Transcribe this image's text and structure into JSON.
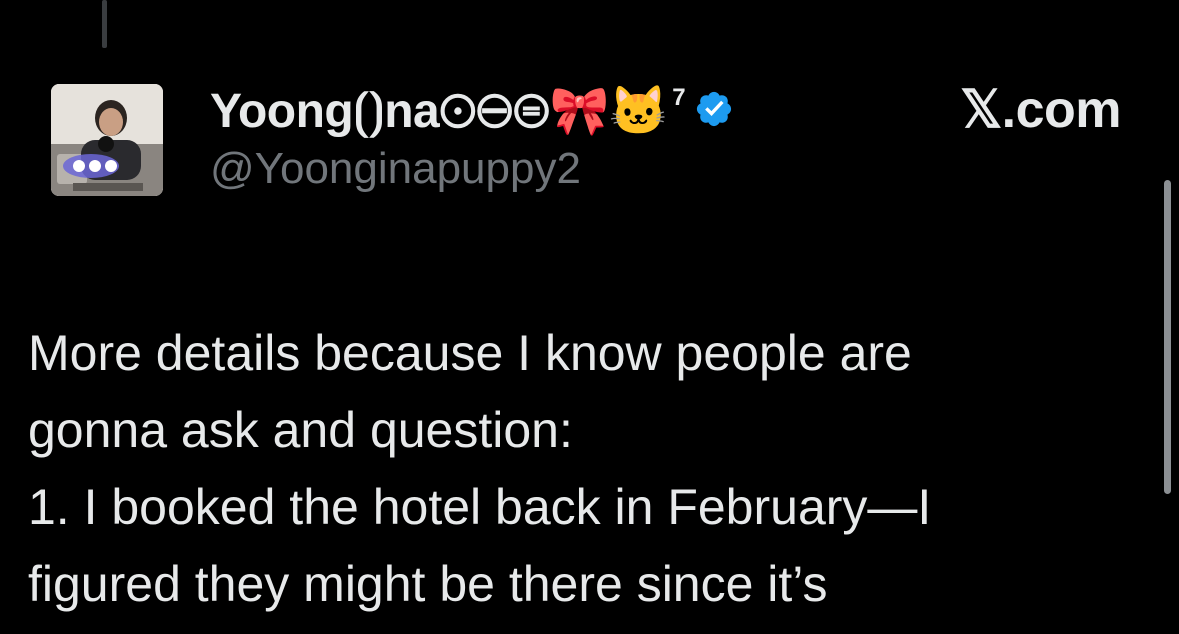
{
  "author": {
    "display_name": "Yoong⟮⟯na⊙⊖⊜🎀🐱",
    "superscript": "7",
    "handle": "@Yoonginapuppy2",
    "verified": true,
    "avatar_icon": "profile-photo"
  },
  "site": {
    "label": "𝕏.com"
  },
  "post": {
    "lines": [
      "More details because I know people are",
      "gonna ask and question:",
      "1. I booked the hotel back in February—I",
      "figured they might be there since it’s"
    ]
  },
  "colors": {
    "background": "#000000",
    "text": "#e7e9ea",
    "handle": "#71767b",
    "verified": "#1d9bf0"
  }
}
